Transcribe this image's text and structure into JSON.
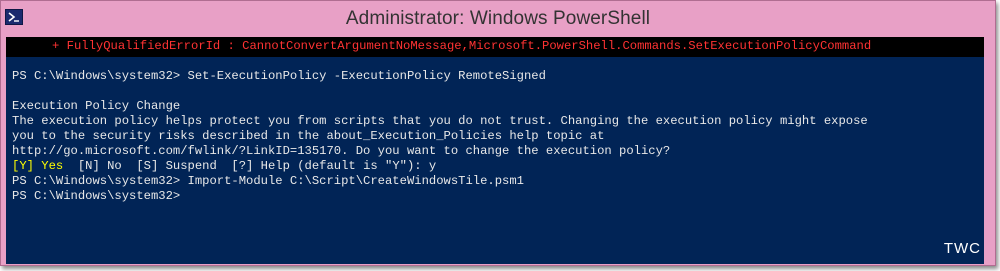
{
  "window": {
    "title": "Administrator: Windows PowerShell"
  },
  "console": {
    "error_line": "+ FullyQualifiedErrorId : CannotConvertArgumentNoMessage,Microsoft.PowerShell.Commands.SetExecutionPolicyCommand",
    "lines": [
      "PS C:\\Windows\\system32> Set-ExecutionPolicy -ExecutionPolicy RemoteSigned",
      "",
      "Execution Policy Change",
      "The execution policy helps protect you from scripts that you do not trust. Changing the execution policy might expose",
      "you to the security risks described in the about_Execution_Policies help topic at",
      "http://go.microsoft.com/fwlink/?LinkID=135170. Do you want to change the execution policy?"
    ],
    "prompt_yes": "[Y] Yes",
    "prompt_rest": "  [N] No  [S] Suspend  [?] Help (default is \"Y\"): y",
    "lines_after": [
      "PS C:\\Windows\\system32> Import-Module C:\\Script\\CreateWindowsTile.psm1",
      "PS C:\\Windows\\system32>"
    ]
  },
  "watermark": "TWC",
  "colors": {
    "console_bg": "#012456",
    "title_bar": "#e8a0c6",
    "error_text": "#ff3333",
    "prompt_highlight": "#ffff00"
  },
  "icons": {
    "app": "powershell-icon"
  }
}
